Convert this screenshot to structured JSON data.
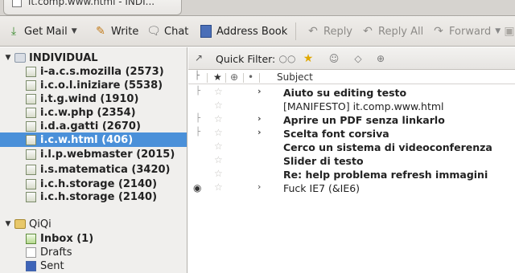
{
  "window": {
    "tab_title": "it.comp.www.html - INDI..."
  },
  "toolbar": {
    "get_mail": "Get Mail",
    "write": "Write",
    "chat": "Chat",
    "address_book": "Address Book",
    "reply": "Reply",
    "reply_all": "Reply All",
    "forward": "Forward"
  },
  "accounts": [
    {
      "name": "INDIVIDUAL",
      "folders": [
        {
          "label": "i-a.c.s.mozilla (2573)"
        },
        {
          "label": "i.c.o.l.iniziare (5538)"
        },
        {
          "label": "i.t.g.wind (1910)"
        },
        {
          "label": "i.c.w.php (2354)"
        },
        {
          "label": "i.d.a.gatti (2670)"
        },
        {
          "label": "i.c.w.html (406)"
        },
        {
          "label": "i.l.p.webmaster (2015)"
        },
        {
          "label": "i.s.matematica (3420)"
        },
        {
          "label": "i.c.h.storage (2140)"
        },
        {
          "label": "i.c.h.storage (2140)"
        }
      ]
    },
    {
      "name": "QiQi",
      "folders": [
        {
          "label": "Inbox (1)"
        },
        {
          "label": "Drafts"
        },
        {
          "label": "Sent"
        }
      ]
    }
  ],
  "quick_filter": {
    "label": "Quick Filter:"
  },
  "columns": {
    "subject": "Subject"
  },
  "messages": [
    {
      "subject": "Aiuto su editing testo"
    },
    {
      "subject": "[MANIFESTO] it.comp.www.html"
    },
    {
      "subject": "Aprire un PDF senza linkarlo"
    },
    {
      "subject": "Scelta font corsiva"
    },
    {
      "subject": "Cerco un sistema di videoconferenza"
    },
    {
      "subject": "Slider di testo"
    },
    {
      "subject": "Re: help problema refresh immagini"
    },
    {
      "subject": "Fuck IE7 (&IE6)"
    }
  ],
  "colors": {
    "selection": "#4a90d9",
    "star": "#e0a800"
  }
}
